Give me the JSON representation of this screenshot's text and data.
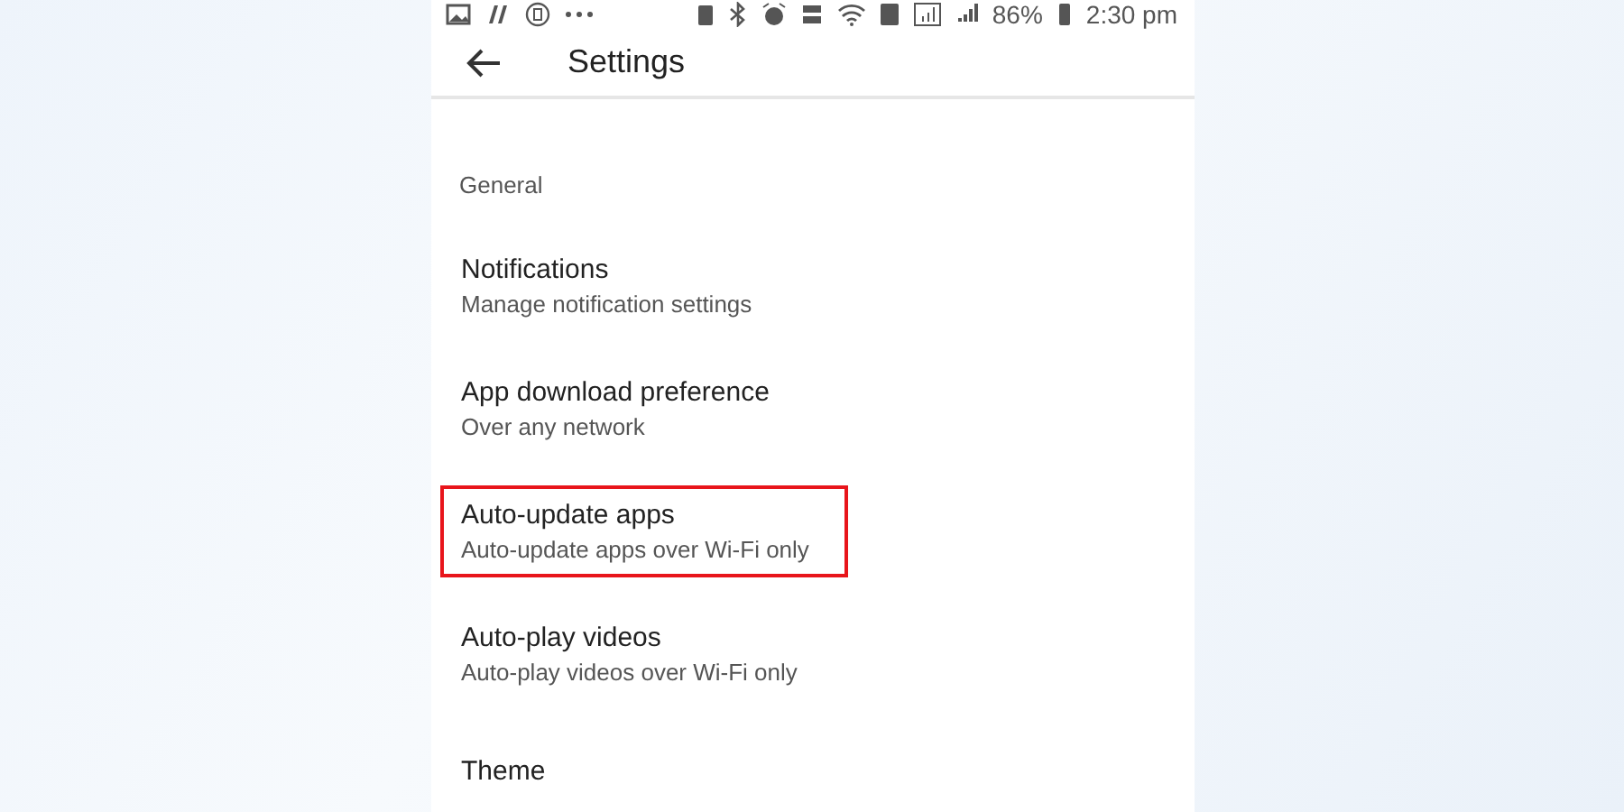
{
  "status_bar": {
    "battery": "86%",
    "time": "2:30 pm"
  },
  "toolbar": {
    "title": "Settings"
  },
  "section": "General",
  "items": [
    {
      "title": "Notifications",
      "subtitle": "Manage notification settings",
      "highlighted": false
    },
    {
      "title": "App download preference",
      "subtitle": "Over any network",
      "highlighted": false
    },
    {
      "title": "Auto-update apps",
      "subtitle": "Auto-update apps over Wi-Fi only",
      "highlighted": true
    },
    {
      "title": "Auto-play videos",
      "subtitle": "Auto-play videos over Wi-Fi only",
      "highlighted": false
    },
    {
      "title": "Theme",
      "highlighted": false
    }
  ]
}
